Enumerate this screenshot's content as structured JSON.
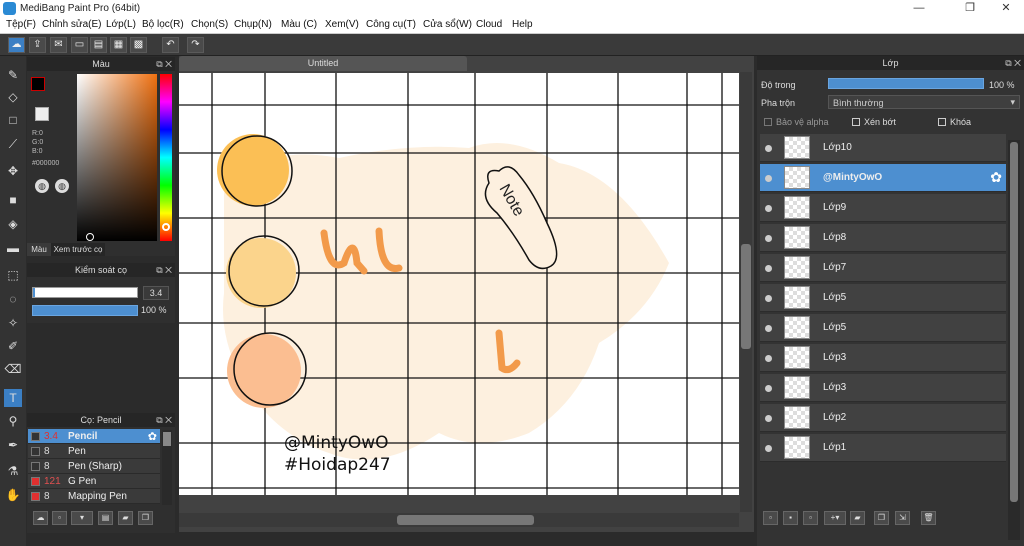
{
  "app": {
    "title": "MediBang Paint Pro (64bit)",
    "doc_tab": "Untitled"
  },
  "menu": [
    "Tệp(F)",
    "Chỉnh sửa(E)",
    "Lớp(L)",
    "Bộ lọc(R)",
    "Chọn(S)",
    "Chụp(N)",
    "Màu (C)",
    "Xem(V)",
    "Công cụ(T)",
    "Cửa sổ(W)",
    "Cloud",
    "Help"
  ],
  "color_panel": {
    "title": "Màu",
    "r": "R:0",
    "g": "G:0",
    "b": "B:0",
    "hex": "#000000",
    "tab1": "Màu",
    "tab2": "Xem trước cọ"
  },
  "brush_control": {
    "title": "Kiểm soát cọ",
    "size": "3.4",
    "opacity": "100 %"
  },
  "brush_panel": {
    "title": "Cọ: Pencil",
    "items": [
      {
        "size": "3.4",
        "name": "Pencil",
        "color": "#333333"
      },
      {
        "size": "8",
        "name": "Pen",
        "color": "#333333"
      },
      {
        "size": "8",
        "name": "Pen (Sharp)",
        "color": "#333333"
      },
      {
        "size": "121",
        "name": "G Pen",
        "color": "#e03030"
      },
      {
        "size": "8",
        "name": "Mapping Pen",
        "color": "#e03030"
      }
    ]
  },
  "layer_panel": {
    "title": "Lớp",
    "opacity_label": "Độ trong",
    "opacity_value": "100 %",
    "blend_label": "Pha trộn",
    "blend_value": "Bình thường",
    "protect_alpha": "Bảo vệ alpha",
    "clip": "Xén bớt",
    "lock": "Khóa",
    "layers": [
      "Lớp10",
      "@MintyOwO",
      "Lớp9",
      "Lớp8",
      "Lớp7",
      "Lớp5",
      "Lớp5",
      "Lớp3",
      "Lớp3",
      "Lớp2",
      "Lớp1"
    ]
  },
  "canvas_text": {
    "handle": "@MintyOwO",
    "tag": "#Hoidap247",
    "note": "Note"
  },
  "colors": {
    "accent": "#4d8fd0",
    "circle1": "#fbbf55",
    "circle2": "#fbd48c",
    "circle3": "#fbbe91",
    "bg_blob": "#fdf0df"
  }
}
